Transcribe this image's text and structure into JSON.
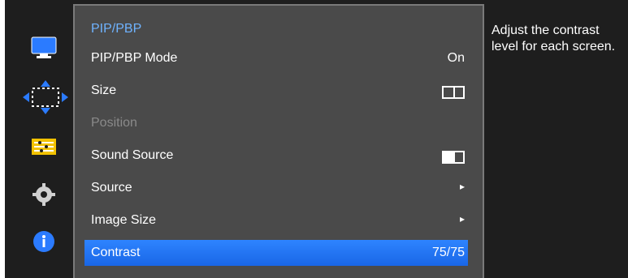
{
  "menu": {
    "title": "PIP/PBP",
    "items": [
      {
        "label": "PIP/PBP Mode",
        "value": "On"
      },
      {
        "label": "Size",
        "value": "",
        "icon": "split-screen-icon"
      },
      {
        "label": "Position",
        "value": "",
        "disabled": true
      },
      {
        "label": "Sound Source",
        "value": "",
        "icon": "sound-source-icon"
      },
      {
        "label": "Source",
        "value": "▸"
      },
      {
        "label": "Image Size",
        "value": "▸"
      },
      {
        "label": "Contrast",
        "value": "75/75",
        "selected": true
      }
    ]
  },
  "help": {
    "text": "Adjust the contrast level for each screen."
  },
  "sidebar": {
    "icons": [
      {
        "name": "monitor-icon"
      },
      {
        "name": "arrows-move-icon"
      },
      {
        "name": "sliders-icon"
      },
      {
        "name": "gear-icon"
      },
      {
        "name": "info-icon"
      }
    ]
  },
  "colors": {
    "accent": "#2e84ff",
    "title": "#6fb3ff"
  }
}
